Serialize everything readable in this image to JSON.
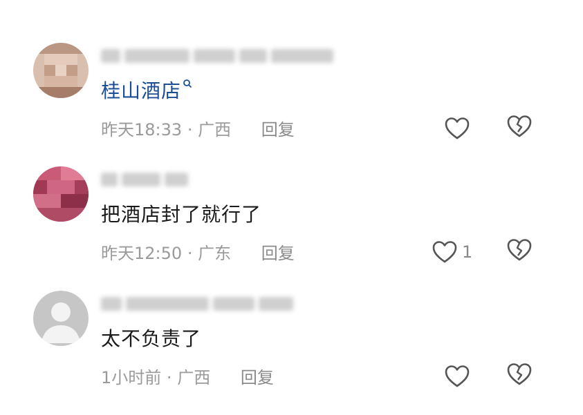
{
  "comments": [
    {
      "content": "桂山酒店",
      "content_is_link": true,
      "time": "昨天18:33",
      "location": "广西",
      "reply": "回复",
      "like_count": "",
      "avatar_colors": [
        "#caa38a",
        "#a87b66",
        "#e3c9b6"
      ]
    },
    {
      "content": "把酒店封了就行了",
      "content_is_link": false,
      "time": "昨天12:50",
      "location": "广东",
      "reply": "回复",
      "like_count": "1",
      "avatar_colors": [
        "#b6475f",
        "#d56b83",
        "#8a2f48"
      ]
    },
    {
      "content": "太不负责了",
      "content_is_link": false,
      "time": "1小时前",
      "location": "广西",
      "reply": "回复",
      "like_count": "",
      "avatar_colors": [
        "#c8c8c8",
        "#f2f2f2",
        "#bdbdbd"
      ]
    }
  ],
  "separator": "·",
  "colors": {
    "link": "#1b4d96",
    "text": "#1a1a1a",
    "meta": "#9a9a9a",
    "icon": "#555555"
  }
}
